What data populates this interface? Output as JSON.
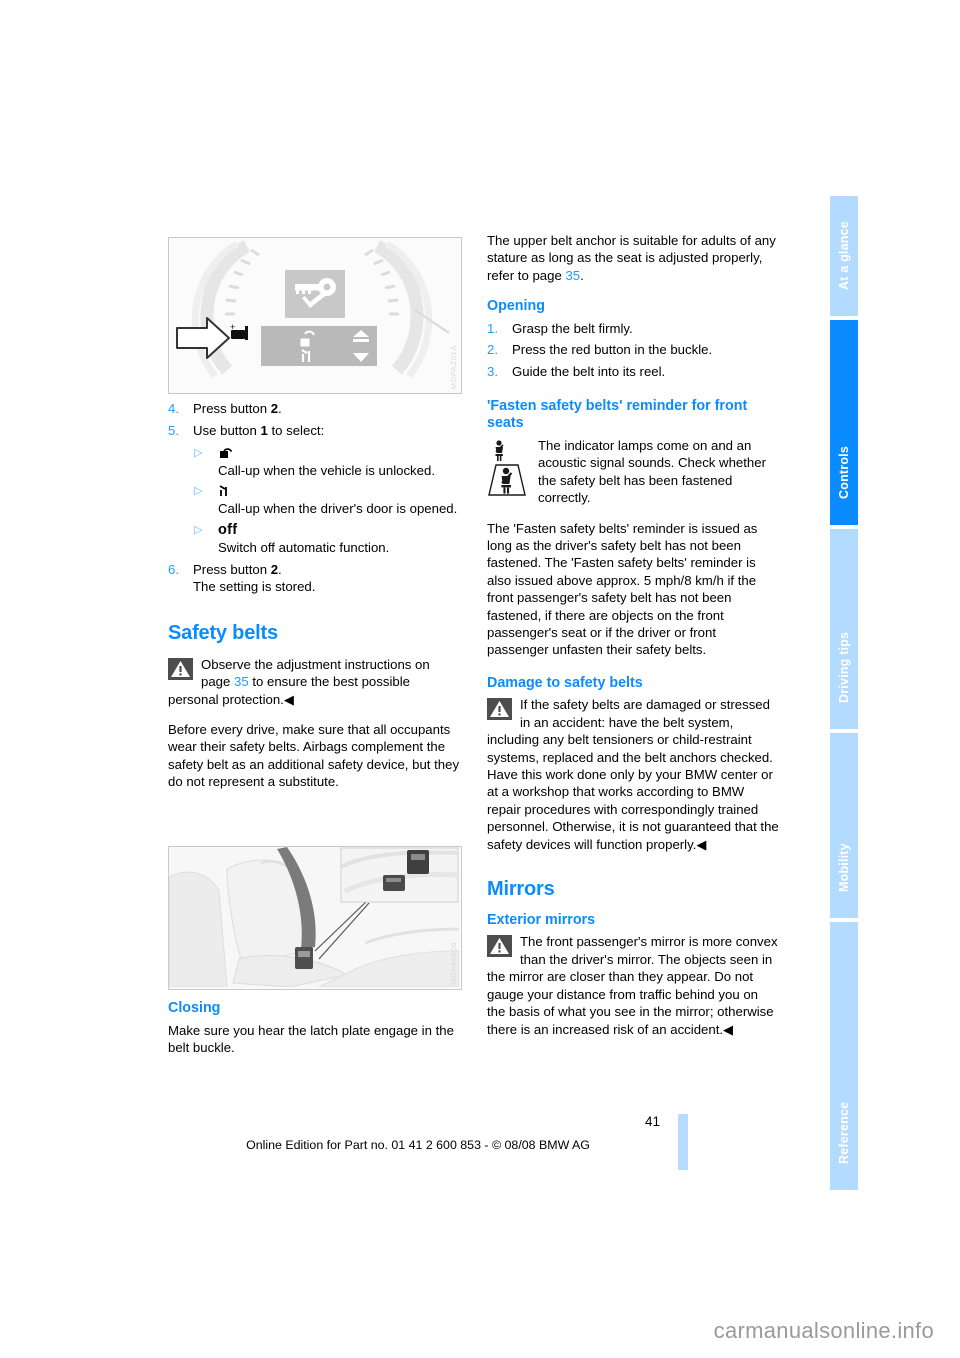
{
  "document": {
    "page_number": "41",
    "edition_line": "Online Edition for Part no. 01 41 2 600 853 - © 08/08 BMW AG",
    "site_watermark": "carmanualsonline.info",
    "accent_color": "#0a8cff",
    "tab_inactive_color": "#b3daff"
  },
  "tabs": [
    {
      "label": "At a glance",
      "active": false
    },
    {
      "label": "Controls",
      "active": true
    },
    {
      "label": "Driving tips",
      "active": false
    },
    {
      "label": "Mobility",
      "active": false
    },
    {
      "label": "Reference",
      "active": false
    }
  ],
  "figures": {
    "cluster": {
      "name": "instrument-cluster-display",
      "watermark": "MOPAZ01A"
    },
    "belt": {
      "name": "front-seat-safety-belt-buckle",
      "watermark": "MOPA6906"
    }
  },
  "left_column": {
    "steps": [
      {
        "num": "4.",
        "text_before": "Press button ",
        "bold": "2",
        "text_after": "."
      },
      {
        "num": "5.",
        "text_before": "Use button ",
        "bold": "1",
        "text_after": " to select:"
      }
    ],
    "sub_items": [
      {
        "icon": "unlocked-padlock-icon",
        "glyph_label": "padlock-open",
        "text": "Call-up when the vehicle is unlocked."
      },
      {
        "icon": "open-door-icon",
        "glyph_label": "door-open",
        "text": "Call-up when the driver's door is opened."
      },
      {
        "icon": "off-text-icon",
        "glyph_label": "off",
        "text": "Switch off automatic function."
      }
    ],
    "step6": {
      "num": "6.",
      "text_before": "Press button ",
      "bold": "2",
      "text_after": ".",
      "second_line": "The setting is stored."
    },
    "safety_belts_heading": "Safety belts",
    "warning_note": {
      "part1": "Observe the adjustment instructions on page ",
      "page_ref": "35",
      "part2": " to ensure the best possible personal protection.◀"
    },
    "body_paragraph": "Before every drive, make sure that all occupants wear their safety belts. Airbags complement the safety belt as an additional safety device, but they do not represent a substitute.",
    "closing_heading": "Closing",
    "closing_text": "Make sure you hear the latch plate engage in the belt buckle."
  },
  "right_column": {
    "intro": {
      "part1": "The upper belt anchor is suitable for adults of any stature as long as the seat is adjusted properly, refer to page ",
      "page_ref": "35",
      "part2": "."
    },
    "opening_heading": "Opening",
    "opening_steps": [
      {
        "num": "1.",
        "text": "Grasp the belt firmly."
      },
      {
        "num": "2.",
        "text": "Press the red button in the buckle."
      },
      {
        "num": "3.",
        "text": "Guide the belt into its reel."
      }
    ],
    "reminder_heading": "'Fasten safety belts' reminder for front seats",
    "reminder_note": "The indicator lamps come on and an acoustic signal sounds. Check whether the safety belt has been fastened correctly.",
    "reminder_body": "The 'Fasten safety belts' reminder is issued as long as the driver's safety belt has not been fastened. The 'Fasten safety belts' reminder is also issued above approx. 5 mph/8 km/h if the front passenger's safety belt has not been fastened, if there are objects on the front passenger's seat or if the driver or front passenger unfasten their safety belts.",
    "damage_heading": "Damage to safety belts",
    "damage_note": "If the safety belts are damaged or stressed in an accident: have the belt system, including any belt tensioners or child-restraint systems, replaced and the belt anchors checked. Have this work done only by your BMW center or at a workshop that works according to BMW repair procedures with correspondingly trained personnel. Otherwise, it is not guaranteed that the safety devices will function properly.◀",
    "mirrors_heading": "Mirrors",
    "exterior_mirrors_heading": "Exterior mirrors",
    "exterior_mirrors_note": "The front passenger's mirror is more convex than the driver's mirror. The objects seen in the mirror are closer than they appear. Do not gauge your distance from traffic behind you on the basis of what you see in the mirror; otherwise there is an increased risk of an accident.◀"
  }
}
